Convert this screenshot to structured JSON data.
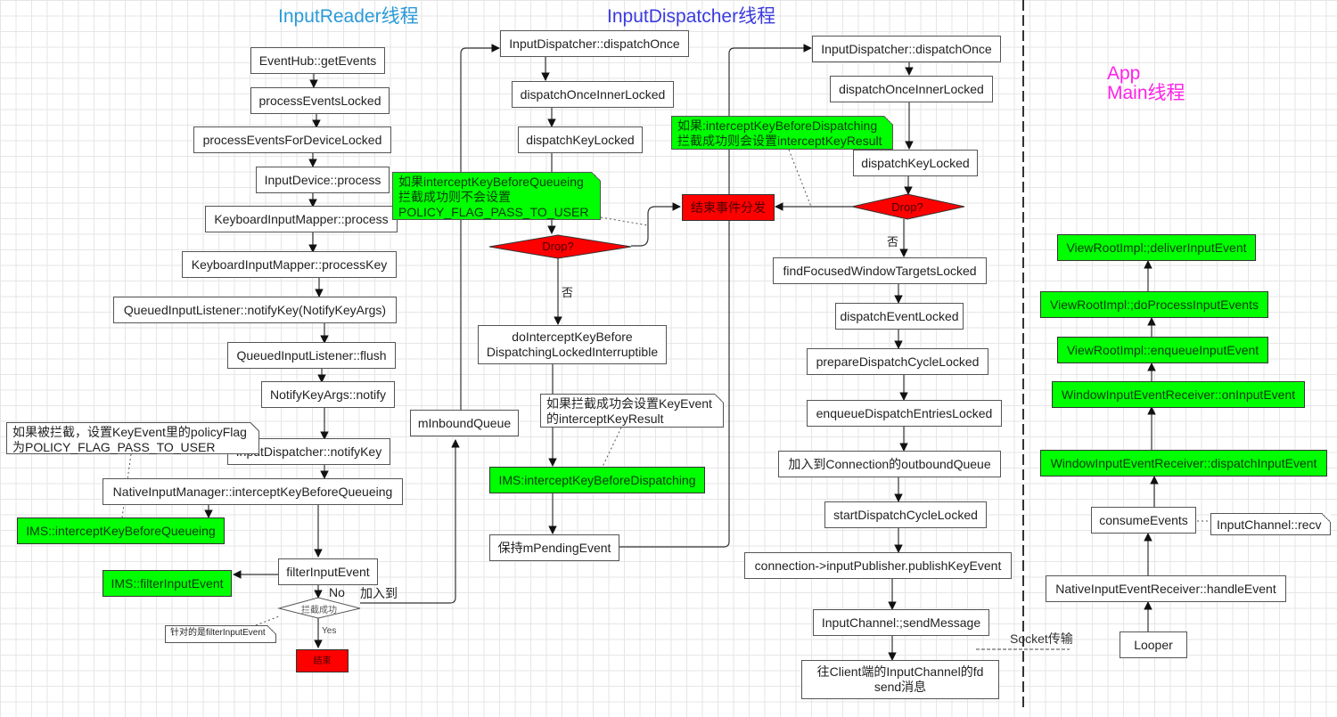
{
  "titles": {
    "input_reader": "InputReader线程",
    "input_dispatcher": "InputDispatcher线程",
    "app_main_line1": "App",
    "app_main_line2": "Main线程"
  },
  "colors": {
    "input_reader_title": "#2a9ad8",
    "input_dispatcher_title": "#3b3be0",
    "app_main_title": "#ff22e8",
    "green_fill": "#00ff00",
    "red_fill": "#ff0000"
  },
  "reader": {
    "get_events": "EventHub::getEvents",
    "process_events_locked": "processEventsLocked",
    "process_events_for_device_locked": "processEventsForDeviceLocked",
    "input_device_process": "InputDevice::process",
    "keyboard_mapper_process": "KeyboardInputMapper::process",
    "keyboard_mapper_process_key": "KeyboardInputMapper::processKey",
    "queued_listener_notify_key": "QueuedInputListener::notifyKey(NotifyKeyArgs)",
    "queued_listener_flush": "QueuedInputListener::flush",
    "notify_key_args_notify": "NotifyKeyArgs::notify",
    "input_dispatcher_notify_key": "InputDispatcher::notifyKey",
    "native_intercept_before_queueing": "NativeInputManager::interceptKeyBeforeQueueing",
    "ims_intercept_before_queueing": "IMS::interceptKeyBeforeQueueing",
    "filter_input_event": "filterInputEvent",
    "ims_filter_input_event": "IMS::filterInputEvent",
    "intercept_success_diamond": "拦截成功",
    "end": "结束",
    "no_label": "No",
    "yes_label": "Yes",
    "add_to_label": "加入到",
    "note_policy_flag": "如果被拦截，设置KeyEvent里的policyFlag\n为POLICY_FLAG_PASS_TO_USER",
    "note_filter": "针对的是filterInputEvent"
  },
  "dispatcher": {
    "inbound_queue": "mInboundQueue",
    "dispatch_once": "InputDispatcher::dispatchOnce",
    "dispatch_once_inner_locked": "dispatchOnceInnerLocked",
    "dispatch_key_locked": "dispatchKeyLocked",
    "note_before_queueing": "如果interceptKeyBeforeQueueing\n拦截成功则不会设置\nPOLICY_FLAG_PASS_TO_USER",
    "drop_diamond": "Drop?",
    "no_label": "否",
    "do_intercept_line1": "doInterceptKeyBefore",
    "do_intercept_line2": "DispatchingLockedInterruptible",
    "note_intercept_result": "如果拦截成功会设置KeyEvent\n的interceptKeyResult",
    "ims_intercept_before_dispatching": "IMS:interceptKeyBeforeDispatching",
    "keep_pending_event": "保持mPendingEvent",
    "end_dispatch": "结束事件分发",
    "dispatch_once_2": "InputDispatcher::dispatchOnce",
    "dispatch_once_inner_locked_2": "dispatchOnceInnerLocked",
    "note_before_dispatching": "如果:interceptKeyBeforeDispatching\n拦截成功则会设置interceptKeyResult",
    "dispatch_key_locked_2": "dispatchKeyLocked",
    "drop_diamond_2": "Drop?",
    "no_label_2": "否",
    "find_focused_window_targets": "findFocusedWindowTargetsLocked",
    "dispatch_event_locked": "dispatchEventLocked",
    "prepare_dispatch_cycle": "prepareDispatchCycleLocked",
    "enqueue_dispatch_entries": "enqueueDispatchEntriesLocked",
    "add_to_outbound_queue": "加入到Connection的outboundQueue",
    "start_dispatch_cycle": "startDispatchCycleLocked",
    "publish_key_event": "connection->inputPublisher.publishKeyEvent",
    "send_message": "InputChannel:;sendMessage",
    "send_to_client_line1": "往Client端的InputChannel的fd",
    "send_to_client_line2": "send消息"
  },
  "socket_label": "Socket传输",
  "app": {
    "deliver_input_event": "ViewRootImpl:;deliverInputEvent",
    "do_process_input_events": "ViewRootImpl:;doProcessInputEvents",
    "enqueue_input_event": "ViewRootImpl::enqueueInputEvent",
    "on_input_event": "WindowInputEventReceiver::onInputEvent",
    "dispatch_input_event": "WindowInputEventReceiver::dispatchInputEvent",
    "consume_events": "consumeEvents",
    "note_recv": "InputChannel::recv",
    "handle_event": "NativeInputEventReceiver::handleEvent",
    "looper": "Looper"
  }
}
